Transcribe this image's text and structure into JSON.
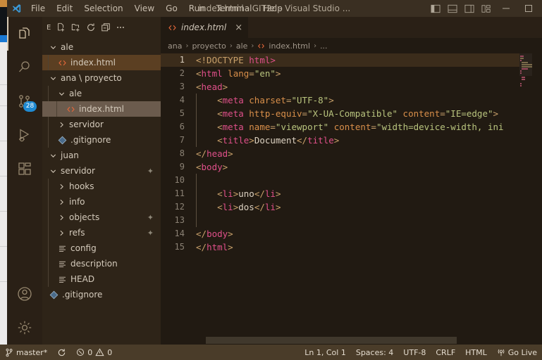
{
  "window": {
    "title": "index.html - GIT2c - Visual Studio ...",
    "menu": [
      "File",
      "Edit",
      "Selection",
      "View",
      "Go",
      "Run",
      "Terminal",
      "Help"
    ],
    "layout_controls": [
      "toggle-primary-sidebar",
      "toggle-panel",
      "toggle-secondary-sidebar",
      "customize-layout"
    ],
    "window_controls": [
      "minimize",
      "maximize"
    ]
  },
  "activitybar": {
    "items": [
      {
        "name": "explorer",
        "active": true
      },
      {
        "name": "search",
        "active": false
      },
      {
        "name": "source-control",
        "active": false,
        "badge": "28"
      },
      {
        "name": "run-and-debug",
        "active": false
      },
      {
        "name": "extensions",
        "active": false
      }
    ],
    "bottom": [
      {
        "name": "accounts"
      },
      {
        "name": "manage-settings"
      }
    ]
  },
  "sidebar": {
    "header_label": "E",
    "actions": [
      "new-file",
      "new-folder",
      "refresh-explorer",
      "collapse-folders",
      "views-and-more-actions"
    ],
    "tree": [
      {
        "label": "ale",
        "type": "folder",
        "expanded": true,
        "indent": 0,
        "state": "none"
      },
      {
        "label": "index.html",
        "type": "html-file",
        "indent": 1,
        "state": "focus"
      },
      {
        "label": "ana \\ proyecto",
        "type": "folder",
        "expanded": true,
        "indent": 0,
        "state": "none"
      },
      {
        "label": "ale",
        "type": "folder",
        "expanded": true,
        "indent": 1,
        "state": "none"
      },
      {
        "label": "index.html",
        "type": "html-file",
        "indent": 2,
        "state": "selected"
      },
      {
        "label": "servidor",
        "type": "folder",
        "expanded": false,
        "indent": 1,
        "state": "none"
      },
      {
        "label": ".gitignore",
        "type": "git-file",
        "indent": 1,
        "state": "none"
      },
      {
        "label": "juan",
        "type": "folder",
        "expanded": true,
        "indent": 0,
        "state": "none"
      },
      {
        "label": "servidor",
        "type": "folder",
        "expanded": true,
        "indent": 0,
        "state": "none",
        "decoration": "modified"
      },
      {
        "label": "hooks",
        "type": "folder",
        "expanded": false,
        "indent": 1,
        "state": "none"
      },
      {
        "label": "info",
        "type": "folder",
        "expanded": false,
        "indent": 1,
        "state": "none"
      },
      {
        "label": "objects",
        "type": "folder",
        "expanded": false,
        "indent": 1,
        "state": "none",
        "decoration": "modified"
      },
      {
        "label": "refs",
        "type": "folder",
        "expanded": false,
        "indent": 1,
        "state": "none",
        "decoration": "modified"
      },
      {
        "label": "config",
        "type": "text-file",
        "indent": 1,
        "state": "none"
      },
      {
        "label": "description",
        "type": "text-file",
        "indent": 1,
        "state": "none"
      },
      {
        "label": "HEAD",
        "type": "text-file",
        "indent": 1,
        "state": "none"
      },
      {
        "label": ".gitignore",
        "type": "git-file",
        "indent": 0,
        "state": "none"
      }
    ]
  },
  "editor": {
    "tab": {
      "label": "index.html",
      "icon": "html-file-icon",
      "close": "×",
      "preview": true
    },
    "breadcrumb": [
      "ana",
      "proyecto",
      "ale",
      "index.html",
      "..."
    ],
    "lines": [
      {
        "n": "1",
        "current": true,
        "indent": 0,
        "tokens": [
          {
            "t": "doc",
            "v": "<!DOCTYPE"
          },
          {
            "t": "plain",
            "v": " "
          },
          {
            "t": "docn2",
            "v": "html>"
          }
        ]
      },
      {
        "n": "2",
        "current": false,
        "indent": 0,
        "tokens": [
          {
            "t": "angle",
            "v": "<"
          },
          {
            "t": "tag",
            "v": "html"
          },
          {
            "t": "plain",
            "v": " "
          },
          {
            "t": "attr",
            "v": "lang"
          },
          {
            "t": "angle",
            "v": "="
          },
          {
            "t": "str",
            "v": "\"en\""
          },
          {
            "t": "angle",
            "v": ">"
          }
        ]
      },
      {
        "n": "3",
        "current": false,
        "indent": 0,
        "tokens": [
          {
            "t": "angle",
            "v": "<"
          },
          {
            "t": "tag",
            "v": "head"
          },
          {
            "t": "angle",
            "v": ">"
          }
        ]
      },
      {
        "n": "4",
        "current": false,
        "indent": 1,
        "tokens": [
          {
            "t": "angle",
            "v": "    <"
          },
          {
            "t": "tag",
            "v": "meta"
          },
          {
            "t": "plain",
            "v": " "
          },
          {
            "t": "attr",
            "v": "charset"
          },
          {
            "t": "angle",
            "v": "="
          },
          {
            "t": "str",
            "v": "\"UTF-8\""
          },
          {
            "t": "angle",
            "v": ">"
          }
        ]
      },
      {
        "n": "5",
        "current": false,
        "indent": 1,
        "tokens": [
          {
            "t": "angle",
            "v": "    <"
          },
          {
            "t": "tag",
            "v": "meta"
          },
          {
            "t": "plain",
            "v": " "
          },
          {
            "t": "attr",
            "v": "http-equiv"
          },
          {
            "t": "angle",
            "v": "="
          },
          {
            "t": "str",
            "v": "\"X-UA-Compatible\""
          },
          {
            "t": "plain",
            "v": " "
          },
          {
            "t": "attr",
            "v": "content"
          },
          {
            "t": "angle",
            "v": "="
          },
          {
            "t": "str",
            "v": "\"IE=edge\""
          },
          {
            "t": "angle",
            "v": ">"
          }
        ]
      },
      {
        "n": "6",
        "current": false,
        "indent": 1,
        "tokens": [
          {
            "t": "angle",
            "v": "    <"
          },
          {
            "t": "tag",
            "v": "meta"
          },
          {
            "t": "plain",
            "v": " "
          },
          {
            "t": "attr",
            "v": "name"
          },
          {
            "t": "angle",
            "v": "="
          },
          {
            "t": "str",
            "v": "\"viewport\""
          },
          {
            "t": "plain",
            "v": " "
          },
          {
            "t": "attr",
            "v": "content"
          },
          {
            "t": "angle",
            "v": "="
          },
          {
            "t": "str",
            "v": "\"width=device-width, ini"
          }
        ]
      },
      {
        "n": "7",
        "current": false,
        "indent": 1,
        "tokens": [
          {
            "t": "angle",
            "v": "    <"
          },
          {
            "t": "tag",
            "v": "title"
          },
          {
            "t": "angle",
            "v": ">"
          },
          {
            "t": "txt",
            "v": "Document"
          },
          {
            "t": "angle",
            "v": "</"
          },
          {
            "t": "tag",
            "v": "title"
          },
          {
            "t": "angle",
            "v": ">"
          }
        ]
      },
      {
        "n": "8",
        "current": false,
        "indent": 0,
        "tokens": [
          {
            "t": "angle",
            "v": "</"
          },
          {
            "t": "tag",
            "v": "head"
          },
          {
            "t": "angle",
            "v": ">"
          }
        ]
      },
      {
        "n": "9",
        "current": false,
        "indent": 0,
        "tokens": [
          {
            "t": "angle",
            "v": "<"
          },
          {
            "t": "tag",
            "v": "body"
          },
          {
            "t": "angle",
            "v": ">"
          }
        ]
      },
      {
        "n": "10",
        "current": false,
        "indent": 1,
        "tokens": []
      },
      {
        "n": "11",
        "current": false,
        "indent": 1,
        "tokens": [
          {
            "t": "angle",
            "v": "    <"
          },
          {
            "t": "tag",
            "v": "li"
          },
          {
            "t": "angle",
            "v": ">"
          },
          {
            "t": "txt",
            "v": "uno"
          },
          {
            "t": "angle",
            "v": "</"
          },
          {
            "t": "tag",
            "v": "li"
          },
          {
            "t": "angle",
            "v": ">"
          }
        ]
      },
      {
        "n": "12",
        "current": false,
        "indent": 1,
        "tokens": [
          {
            "t": "angle",
            "v": "    <"
          },
          {
            "t": "tag",
            "v": "li"
          },
          {
            "t": "angle",
            "v": ">"
          },
          {
            "t": "txt",
            "v": "dos"
          },
          {
            "t": "angle",
            "v": "</"
          },
          {
            "t": "tag",
            "v": "li"
          },
          {
            "t": "angle",
            "v": ">"
          }
        ]
      },
      {
        "n": "13",
        "current": false,
        "indent": 1,
        "tokens": []
      },
      {
        "n": "14",
        "current": false,
        "indent": 0,
        "tokens": [
          {
            "t": "angle",
            "v": "</"
          },
          {
            "t": "tag",
            "v": "body"
          },
          {
            "t": "angle",
            "v": ">"
          }
        ]
      },
      {
        "n": "15",
        "current": false,
        "indent": 0,
        "tokens": [
          {
            "t": "angle",
            "v": "</"
          },
          {
            "t": "tag",
            "v": "html"
          },
          {
            "t": "angle",
            "v": ">"
          }
        ]
      }
    ]
  },
  "statusbar": {
    "branch": "master*",
    "sync_icon": "sync-icon",
    "errors": "0",
    "warnings": "0",
    "cursor": "Ln 1, Col 1",
    "indentation": "Spaces: 4",
    "encoding": "UTF-8",
    "eol": "CRLF",
    "language": "HTML",
    "golive": "Go Live"
  },
  "colors": {
    "titlebar_bg": "#3a2f22",
    "sidebar_bg": "#2e2418",
    "editor_bg": "#211a12",
    "statusbar_bg": "#4a3c29",
    "accent_blue": "#1f8ad2",
    "tag_pink": "#e0508a",
    "attr_orange": "#d98f4a",
    "string_green": "#b9c47e"
  }
}
